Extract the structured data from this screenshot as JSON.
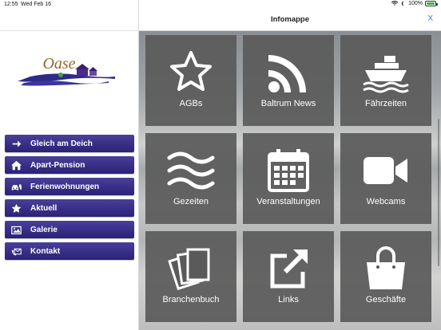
{
  "status": {
    "time": "12:55",
    "date": "Wed Feb 16",
    "battery": "100%",
    "battery_level": 1.0
  },
  "sidebar": {
    "logo_text": "Oase",
    "items": [
      {
        "label": "Gleich am Deich",
        "icon": "arrow-right-icon"
      },
      {
        "label": "Apart-Pension",
        "icon": "home-icon"
      },
      {
        "label": "Ferienwohnungen",
        "icon": "cars-icon"
      },
      {
        "label": "Aktuell",
        "icon": "star-icon"
      },
      {
        "label": "Galerie",
        "icon": "image-icon"
      },
      {
        "label": "Kontakt",
        "icon": "envelope-phone-icon"
      }
    ]
  },
  "header": {
    "title": "Infomappe",
    "close_label": "X"
  },
  "tiles": [
    {
      "label": "AGBs",
      "icon": "star-outline-icon"
    },
    {
      "label": "Baltrum News",
      "icon": "rss-icon"
    },
    {
      "label": "Fährzeiten",
      "icon": "ship-icon"
    },
    {
      "label": "Gezeiten",
      "icon": "waves-icon"
    },
    {
      "label": "Veranstaltungen",
      "icon": "calendar-icon"
    },
    {
      "label": "Webcams",
      "icon": "video-camera-icon"
    },
    {
      "label": "Branchenbuch",
      "icon": "pages-icon"
    },
    {
      "label": "Links",
      "icon": "external-link-icon"
    },
    {
      "label": "Geschäfte",
      "icon": "shopping-bag-icon"
    }
  ],
  "colors": {
    "menu_accent": "#2b2175",
    "link": "#2a7ae2",
    "tile_bg": "#5a5a5a"
  }
}
